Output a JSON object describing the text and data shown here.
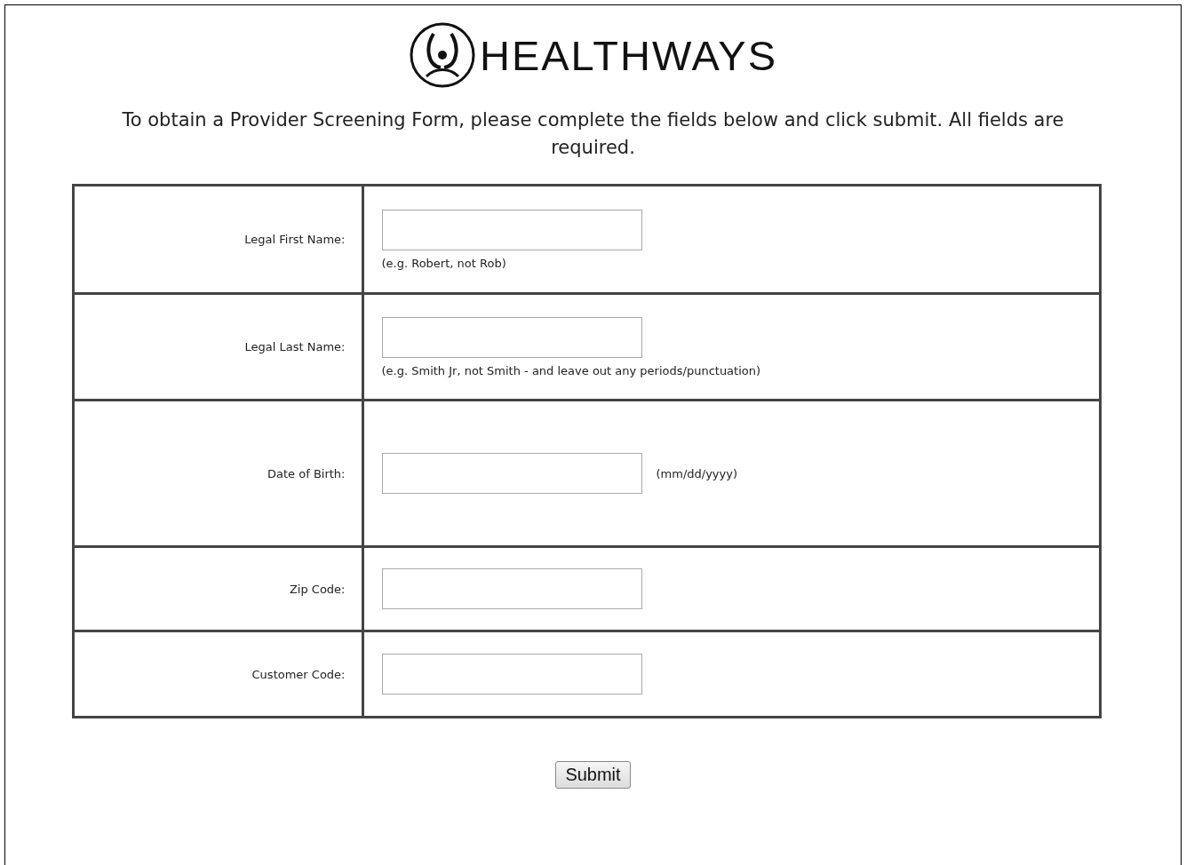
{
  "logo": {
    "text": "HEALTHWAYS"
  },
  "intro": "To obtain a Provider Screening Form, please complete the fields below and click submit. All fields are required.",
  "fields": [
    {
      "label": "Legal First Name:",
      "hint": "(e.g. Robert, not Rob)",
      "kind": "below"
    },
    {
      "label": "Legal Last Name:",
      "hint": "(e.g. Smith Jr, not Smith - and leave out any periods/punctuation)",
      "kind": "below"
    },
    {
      "label": "Date of Birth:",
      "hint": "(mm/dd/yyyy)",
      "kind": "inline"
    },
    {
      "label": "Zip Code:"
    },
    {
      "label": "Customer Code:"
    }
  ],
  "submit": "Submit"
}
